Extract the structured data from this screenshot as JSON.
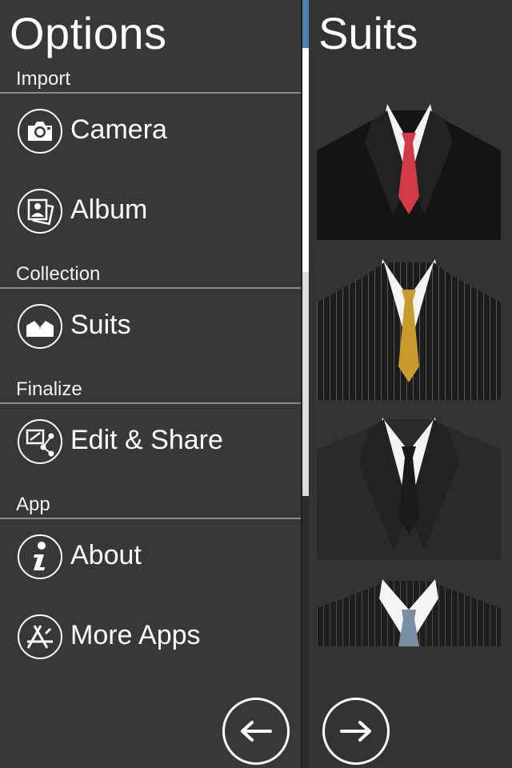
{
  "drawer": {
    "title": "Options",
    "sections": [
      {
        "label": "Import"
      },
      {
        "label": "Collection"
      },
      {
        "label": "Finalize"
      },
      {
        "label": "App"
      }
    ],
    "items": [
      {
        "label": "Camera",
        "icon": "camera-icon"
      },
      {
        "label": "Album",
        "icon": "album-icon"
      },
      {
        "label": "Suits",
        "icon": "suit-icon"
      },
      {
        "label": "Edit & Share",
        "icon": "edit-share-icon"
      },
      {
        "label": "About",
        "icon": "info-icon"
      },
      {
        "label": "More Apps",
        "icon": "app-store-icon"
      }
    ],
    "back_button_icon": "arrow-left-icon"
  },
  "suits_panel": {
    "title": "Suits",
    "thumbnails": [
      {
        "tie_color": "#d23a4a",
        "stripes": false
      },
      {
        "tie_color": "#c99a2e",
        "stripes": true
      },
      {
        "tie_color": "#1a1a1a",
        "stripes": false
      },
      {
        "tie_color": "#7c8ea6",
        "stripes": true
      }
    ],
    "next_button_icon": "arrow-right-icon"
  },
  "colors": {
    "drawer_bg": "#383838",
    "panel_bg": "#333333",
    "text": "#ffffff"
  }
}
